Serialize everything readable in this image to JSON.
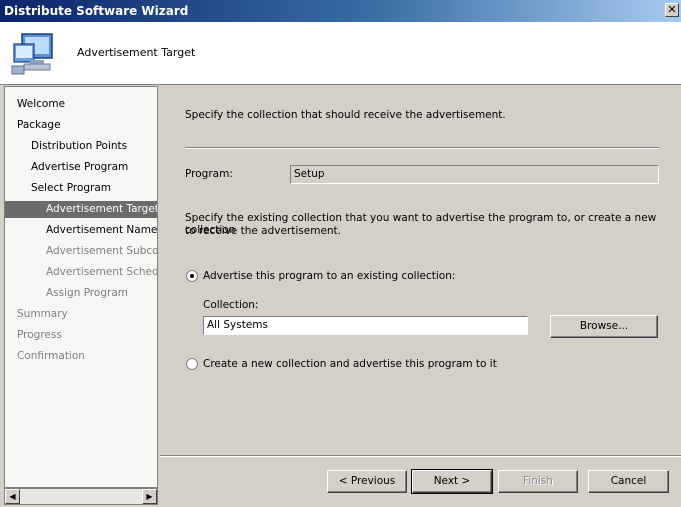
{
  "window": {
    "title": "Distribute Software Wizard",
    "close_glyph": "✕"
  },
  "header": {
    "title": "Advertisement Target",
    "icon": "computer-monitor-icon"
  },
  "steps": [
    {
      "label": "Welcome",
      "state": "done"
    },
    {
      "label": "Package",
      "state": "done"
    },
    {
      "label": "Distribution Points",
      "state": "done"
    },
    {
      "label": "Advertise Program",
      "state": "done"
    },
    {
      "label": "Select Program",
      "state": "done"
    },
    {
      "label": "Advertisement Target",
      "state": "active"
    },
    {
      "label": "Advertisement Name",
      "state": "next"
    },
    {
      "label": "Advertisement Subcollec",
      "state": "pending"
    },
    {
      "label": "Advertisement Schedule",
      "state": "pending"
    },
    {
      "label": "Assign Program",
      "state": "pending"
    },
    {
      "label": "Summary",
      "state": "pending"
    },
    {
      "label": "Progress",
      "state": "pending"
    },
    {
      "label": "Confirmation",
      "state": "pending"
    }
  ],
  "main": {
    "instruction": "Specify the collection that should receive the advertisement.",
    "program_label": "Program:",
    "program_value": "Setup",
    "description_line1": "Specify the existing collection that you want to advertise the program to, or create a new collection",
    "description_line2": "to receive the advertisement.",
    "option_existing": {
      "label": "Advertise this program to an existing collection:",
      "selected": true
    },
    "collection_label": "Collection:",
    "collection_value": "All Systems",
    "browse_label": "Browse...",
    "option_new": {
      "label": "Create a new collection and advertise this program to it",
      "selected": false
    }
  },
  "buttons": {
    "previous": "< Previous",
    "next": "Next >",
    "finish": "Finish",
    "cancel": "Cancel"
  },
  "scrollbar": {
    "left_glyph": "◀",
    "right_glyph": "▶"
  }
}
